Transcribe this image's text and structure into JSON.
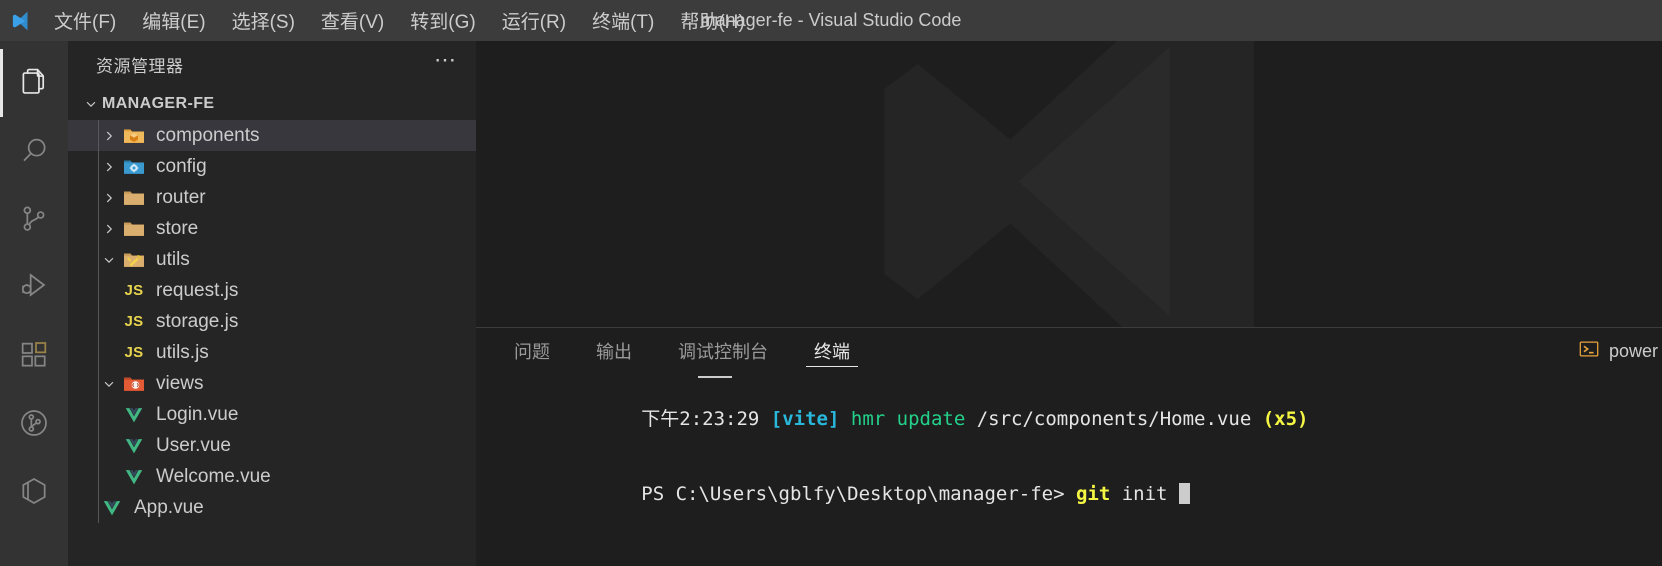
{
  "window": {
    "title": "manager-fe - Visual Studio Code",
    "logo_icon": "vscode-logo-icon"
  },
  "menubar": {
    "items": [
      {
        "label": "文件(F)",
        "name": "menu-file"
      },
      {
        "label": "编辑(E)",
        "name": "menu-edit"
      },
      {
        "label": "选择(S)",
        "name": "menu-selection"
      },
      {
        "label": "查看(V)",
        "name": "menu-view"
      },
      {
        "label": "转到(G)",
        "name": "menu-go"
      },
      {
        "label": "运行(R)",
        "name": "menu-run"
      },
      {
        "label": "终端(T)",
        "name": "menu-terminal"
      },
      {
        "label": "帮助(H)",
        "name": "menu-help"
      }
    ]
  },
  "activitybar": {
    "items": [
      {
        "icon": "explorer-files-icon",
        "name": "activity-bar-explorer",
        "active": true
      },
      {
        "icon": "search-icon",
        "name": "activity-bar-search",
        "active": false
      },
      {
        "icon": "source-control-branch-icon",
        "name": "activity-bar-source-control",
        "active": false
      },
      {
        "icon": "run-and-debug-icon",
        "name": "activity-bar-run-debug",
        "active": false
      },
      {
        "icon": "extensions-blocks-icon",
        "name": "activity-bar-extensions",
        "active": false
      },
      {
        "icon": "gitlens-circle-icon",
        "name": "activity-bar-gitlens",
        "active": false
      },
      {
        "icon": "remote-cube-icon",
        "name": "activity-bar-remote",
        "active": false
      }
    ]
  },
  "sidebar": {
    "title": "资源管理器",
    "more_actions_icon": "ellipsis-icon",
    "root": {
      "label": "MANAGER-FE",
      "expanded": true,
      "chevron_icon": "chevron-down-icon"
    },
    "tree": [
      {
        "label": "components",
        "kind": "folder",
        "icon": "folder-components-icon",
        "indent": 1,
        "expanded": false,
        "selected": true
      },
      {
        "label": "config",
        "kind": "folder",
        "icon": "folder-config-icon",
        "indent": 1,
        "expanded": false,
        "selected": false
      },
      {
        "label": "router",
        "kind": "folder",
        "icon": "folder-plain-icon",
        "indent": 1,
        "expanded": false,
        "selected": false
      },
      {
        "label": "store",
        "kind": "folder",
        "icon": "folder-plain-icon",
        "indent": 1,
        "expanded": false,
        "selected": false
      },
      {
        "label": "utils",
        "kind": "folder",
        "icon": "folder-utils-icon",
        "indent": 1,
        "expanded": true,
        "selected": false
      },
      {
        "label": "request.js",
        "kind": "file",
        "icon": "js-file-icon",
        "indent": 2,
        "selected": false
      },
      {
        "label": "storage.js",
        "kind": "file",
        "icon": "js-file-icon",
        "indent": 2,
        "selected": false
      },
      {
        "label": "utils.js",
        "kind": "file",
        "icon": "js-file-icon",
        "indent": 2,
        "selected": false
      },
      {
        "label": "views",
        "kind": "folder",
        "icon": "folder-views-icon",
        "indent": 1,
        "expanded": true,
        "selected": false
      },
      {
        "label": "Login.vue",
        "kind": "file",
        "icon": "vue-file-icon",
        "indent": 2,
        "selected": false
      },
      {
        "label": "User.vue",
        "kind": "file",
        "icon": "vue-file-icon",
        "indent": 2,
        "selected": false
      },
      {
        "label": "Welcome.vue",
        "kind": "file",
        "icon": "vue-file-icon",
        "indent": 2,
        "selected": false
      },
      {
        "label": "App.vue",
        "kind": "file",
        "icon": "vue-file-icon",
        "indent": 1,
        "selected": false
      }
    ]
  },
  "editor": {
    "watermark_icon": "vscode-watermark-logo-icon"
  },
  "panel": {
    "tabs": [
      {
        "label": "问题",
        "name": "tab-problems",
        "active": false
      },
      {
        "label": "输出",
        "name": "tab-output",
        "active": false
      },
      {
        "label": "调试控制台",
        "name": "tab-debug-console",
        "active": false
      },
      {
        "label": "终端",
        "name": "tab-terminal",
        "active": true
      }
    ],
    "terminal_entry": {
      "icon": "powershell-icon",
      "label": "power"
    }
  },
  "terminal": {
    "lines": [
      {
        "segments": [
          {
            "text": "下午2:23:29 ",
            "color": "white"
          },
          {
            "text": "[vite]",
            "color": "cyan"
          },
          {
            "text": " ",
            "color": "white"
          },
          {
            "text": "hmr update",
            "color": "green"
          },
          {
            "text": " /src/components/Home.vue ",
            "color": "white"
          },
          {
            "text": "(x5)",
            "color": "yellow"
          }
        ]
      },
      {
        "segments": [
          {
            "text": "PS C:\\Users\\gblfy\\Desktop\\manager-fe> ",
            "color": "white"
          },
          {
            "text": "git",
            "color": "yellow"
          },
          {
            "text": " init ",
            "color": "white"
          }
        ],
        "cursor": true
      }
    ]
  },
  "colors": {
    "titlebar_bg": "#3c3c3c",
    "activitybar_bg": "#333333",
    "sidebar_bg": "#252526",
    "editor_bg": "#1e1e1e",
    "selection_bg": "#37373d",
    "foreground": "#cccccc",
    "terminal_cyan": "#29b8db",
    "terminal_green": "#23d18b",
    "terminal_yellow": "#f5f543",
    "powershell_orange": "#e8a33d"
  }
}
